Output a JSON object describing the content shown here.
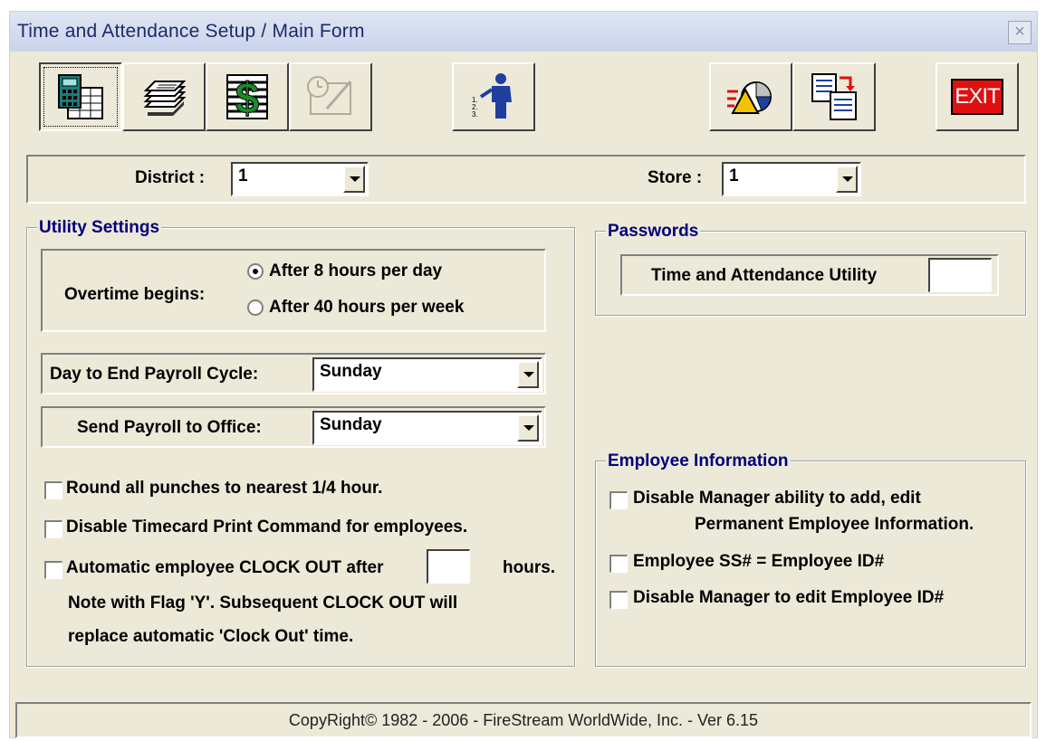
{
  "window": {
    "title": "Time and Attendance Setup / Main Form",
    "close_glyph": "×"
  },
  "toolbar": {
    "buttons": [
      {
        "name": "timecard-button",
        "icon": "calculator-spreadsheet-icon",
        "pressed": true
      },
      {
        "name": "stack-button",
        "icon": "stacked-cards-icon"
      },
      {
        "name": "payroll-button",
        "icon": "dollar-ledger-icon"
      },
      {
        "name": "disabled-button",
        "icon": "clock-edit-icon",
        "disabled": true
      },
      {
        "name": "employee-button",
        "icon": "person-list-icon"
      },
      {
        "name": "report-button",
        "icon": "chart-report-icon"
      },
      {
        "name": "transfer-button",
        "icon": "document-transfer-icon"
      },
      {
        "name": "exit-button",
        "icon": "exit-icon",
        "label": "EXIT"
      }
    ],
    "employee_icon_digits": [
      "1.",
      "2.",
      "3."
    ]
  },
  "location": {
    "district_label": "District :",
    "district_value": "1",
    "store_label": "Store :",
    "store_value": "1"
  },
  "utility": {
    "legend": "Utility Settings",
    "overtime_label": "Overtime begins:",
    "overtime_options": [
      {
        "label": "After 8 hours per day",
        "selected": true
      },
      {
        "label": "After 40 hours per week",
        "selected": false
      }
    ],
    "day_end_label": "Day to End Payroll Cycle:",
    "day_end_value": "Sunday",
    "send_label": "Send Payroll to Office:",
    "send_value": "Sunday",
    "round_label": "Round all punches to nearest 1/4 hour.",
    "disable_print_label": "Disable Timecard Print Command for employees.",
    "auto_clock_label": "Automatic employee CLOCK OUT after",
    "auto_clock_hours_value": "",
    "hours_label": "hours.",
    "note_line1": "Note with Flag 'Y'.  Subsequent CLOCK OUT will",
    "note_line2": "replace automatic 'Clock Out' time."
  },
  "passwords": {
    "legend": "Passwords",
    "utility_label": "Time and Attendance Utility",
    "utility_value": ""
  },
  "employee_info": {
    "legend": "Employee Information",
    "disable_add_line1": "Disable Manager ability to add, edit",
    "disable_add_line2": "Permanent Employee Information.",
    "ss_label": "Employee SS# = Employee ID#",
    "disable_edit_id_label": "Disable Manager to edit Employee ID#"
  },
  "footer": {
    "copyright": "CopyRight© 1982 - 2006 - FireStream WorldWide, Inc. - Ver 6.15"
  },
  "colors": {
    "window_bg": "#ece9d8",
    "title_text": "#1c2a6b",
    "legend_text": "#00007a",
    "exit_red": "#e01010",
    "dollar_green": "#1a8a2a"
  }
}
